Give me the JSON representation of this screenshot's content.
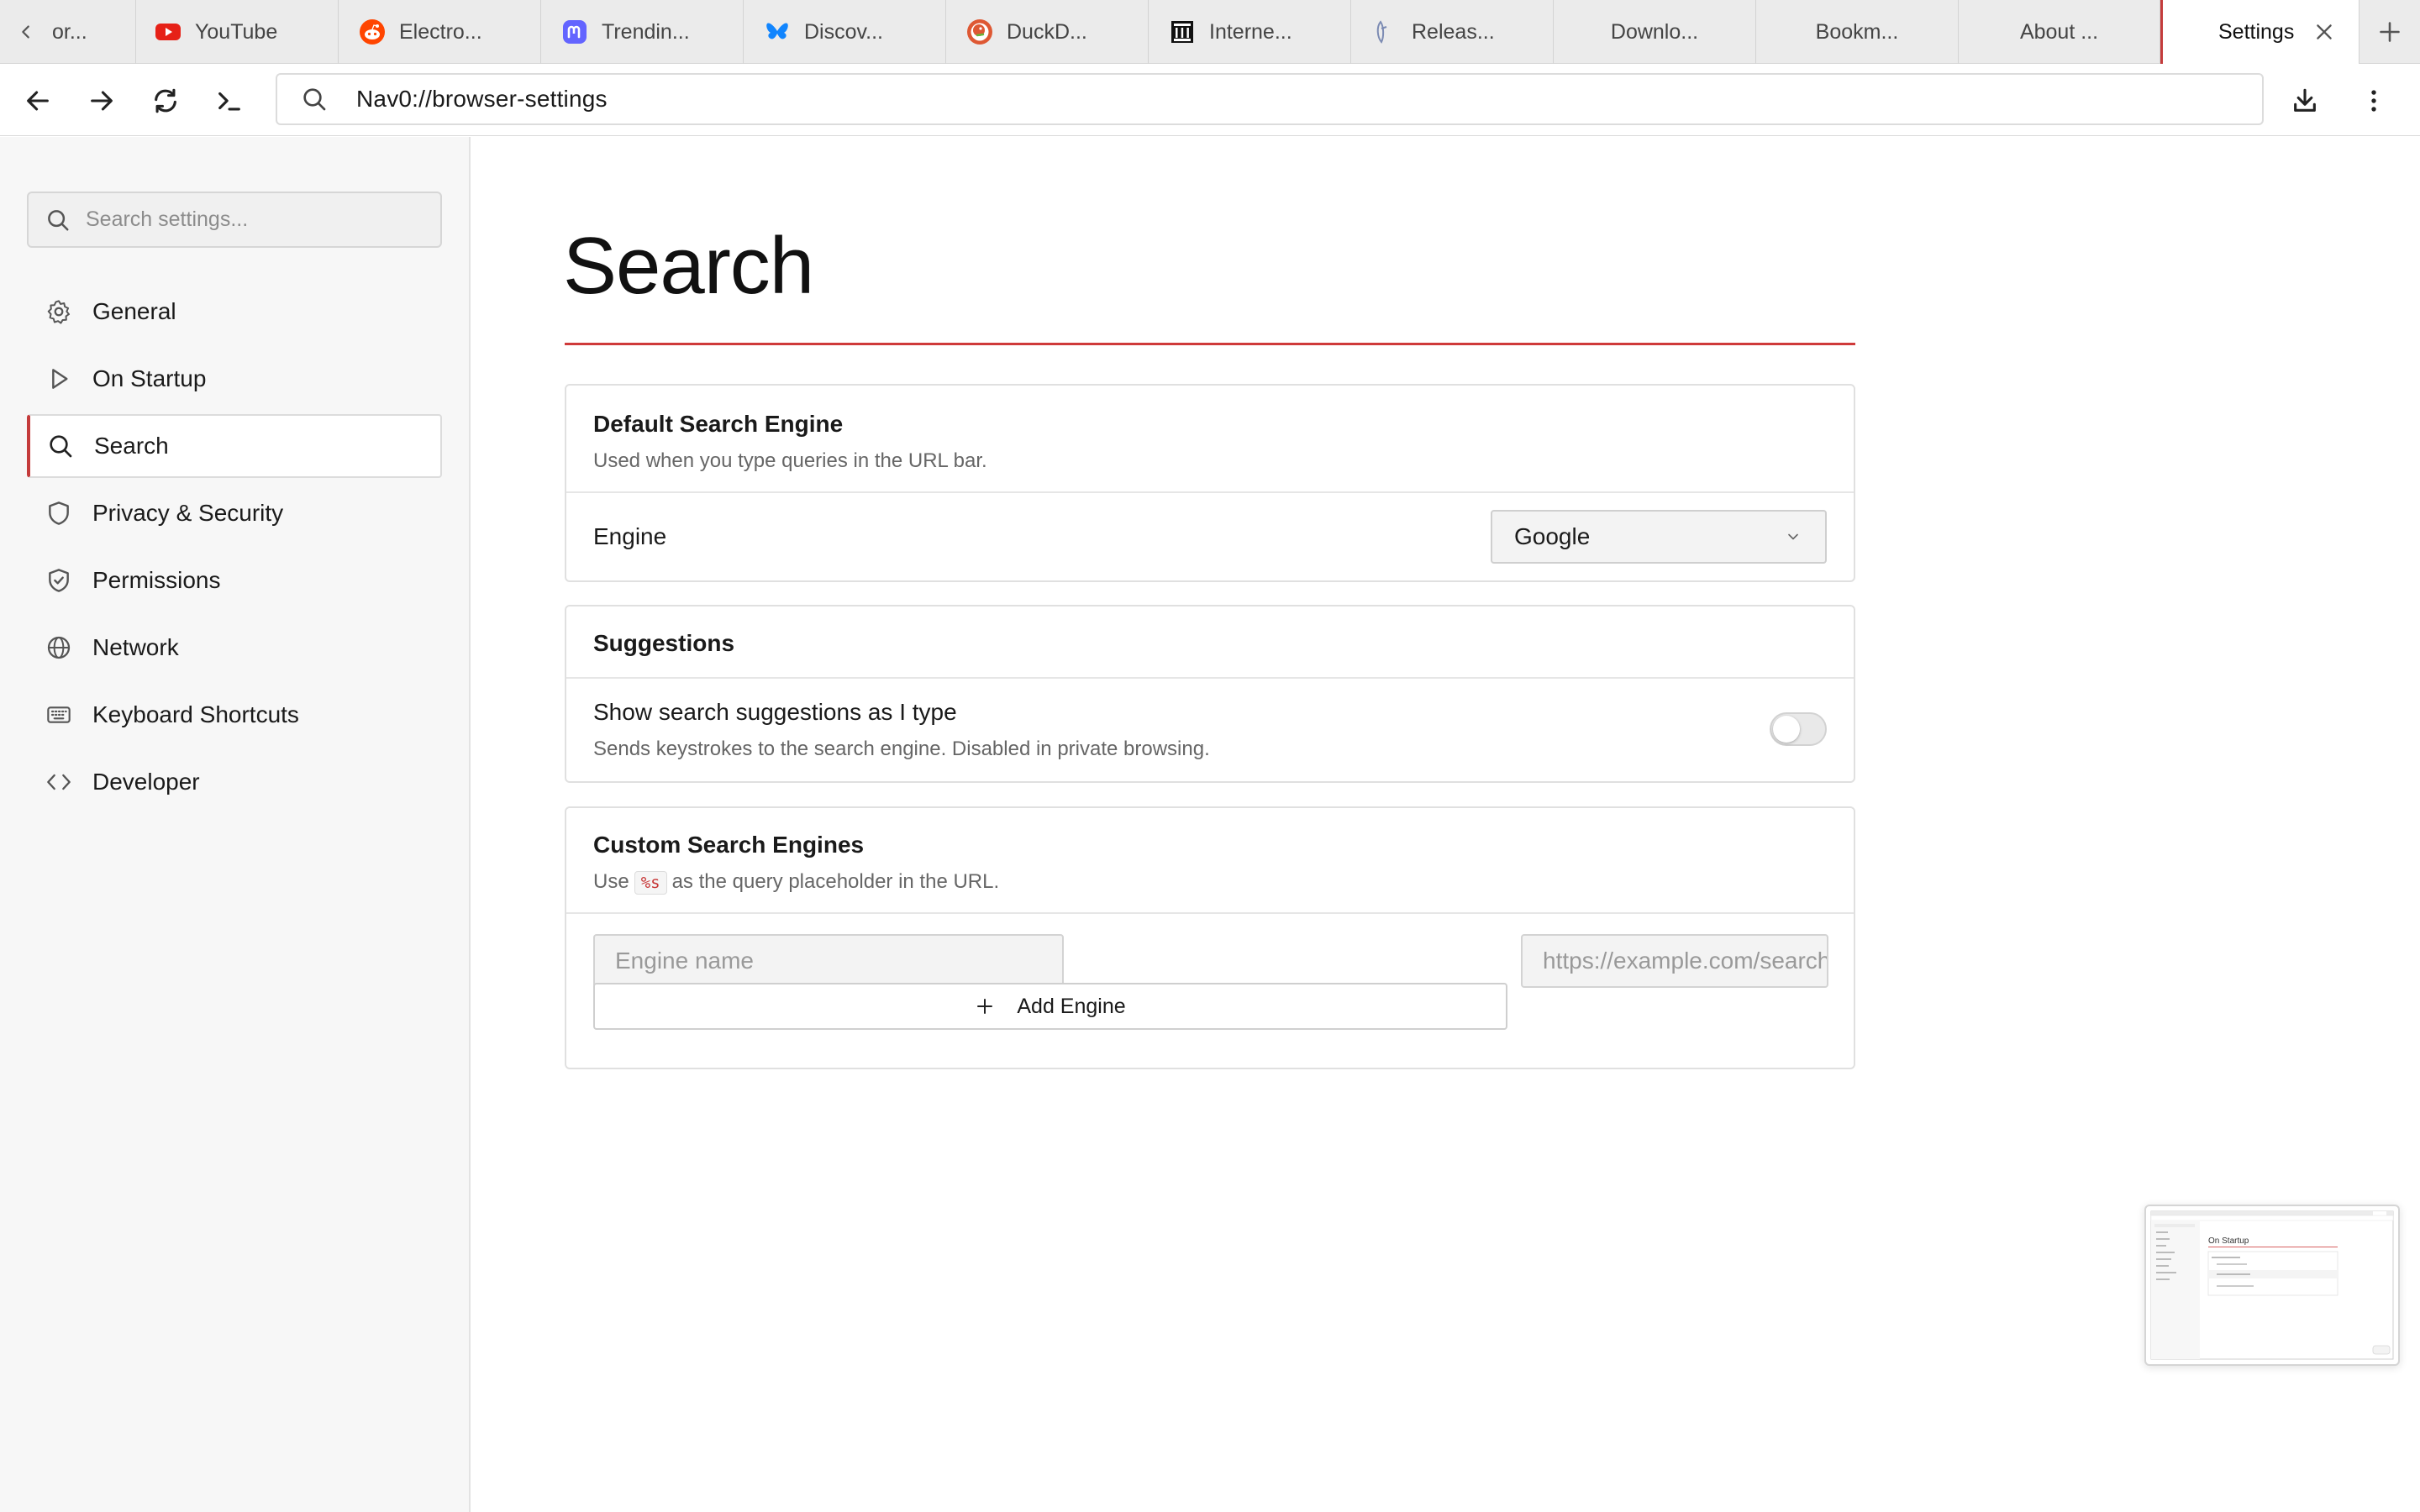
{
  "tabs": [
    {
      "title": "or...",
      "icon": "none"
    },
    {
      "title": "YouTube",
      "icon": "youtube-icon"
    },
    {
      "title": "Electro...",
      "icon": "reddit-icon"
    },
    {
      "title": "Trendin...",
      "icon": "mastodon-icon"
    },
    {
      "title": "Discov...",
      "icon": "bluesky-icon"
    },
    {
      "title": "DuckD...",
      "icon": "duckduckgo-icon"
    },
    {
      "title": "Interne...",
      "icon": "internet-archive-icon"
    },
    {
      "title": "Releas...",
      "icon": "release-icon"
    },
    {
      "title": "Downlo...",
      "icon": "none"
    },
    {
      "title": "Bookm...",
      "icon": "none"
    },
    {
      "title": "About ...",
      "icon": "none"
    },
    {
      "title": "Settings",
      "icon": "none",
      "active": true
    }
  ],
  "toolbar": {
    "url": "Nav0://browser-settings"
  },
  "sidebar": {
    "search_placeholder": "Search settings...",
    "items": [
      {
        "label": "General",
        "icon": "gear-icon"
      },
      {
        "label": "On Startup",
        "icon": "play-icon"
      },
      {
        "label": "Search",
        "icon": "search-icon",
        "active": true
      },
      {
        "label": "Privacy & Security",
        "icon": "shield-icon"
      },
      {
        "label": "Permissions",
        "icon": "shield-check-icon"
      },
      {
        "label": "Network",
        "icon": "globe-icon"
      },
      {
        "label": "Keyboard Shortcuts",
        "icon": "keyboard-icon"
      },
      {
        "label": "Developer",
        "icon": "code-icon"
      }
    ]
  },
  "main": {
    "title": "Search",
    "default_engine": {
      "title": "Default Search Engine",
      "description": "Used when you type queries in the URL bar.",
      "engine_label": "Engine",
      "engine_value": "Google"
    },
    "suggestions": {
      "title": "Suggestions",
      "toggle_label": "Show search suggestions as I type",
      "toggle_description": "Sends keystrokes to the search engine. Disabled in private browsing.",
      "enabled": false
    },
    "custom_engines": {
      "title": "Custom Search Engines",
      "desc_prefix": "Use",
      "desc_code": "%s",
      "desc_suffix": "as the query placeholder in the URL.",
      "name_placeholder": "Engine name",
      "url_placeholder": "https://example.com/search?q=%s",
      "add_label": "Add Engine"
    }
  },
  "preview": {
    "heading": "On Startup"
  },
  "colors": {
    "accent": "#c43b3b",
    "youtube": "#e62117",
    "reddit": "#ff4500",
    "mastodon": "#6364ff",
    "bluesky": "#1185fe",
    "duckduckgo": "#de5833"
  }
}
